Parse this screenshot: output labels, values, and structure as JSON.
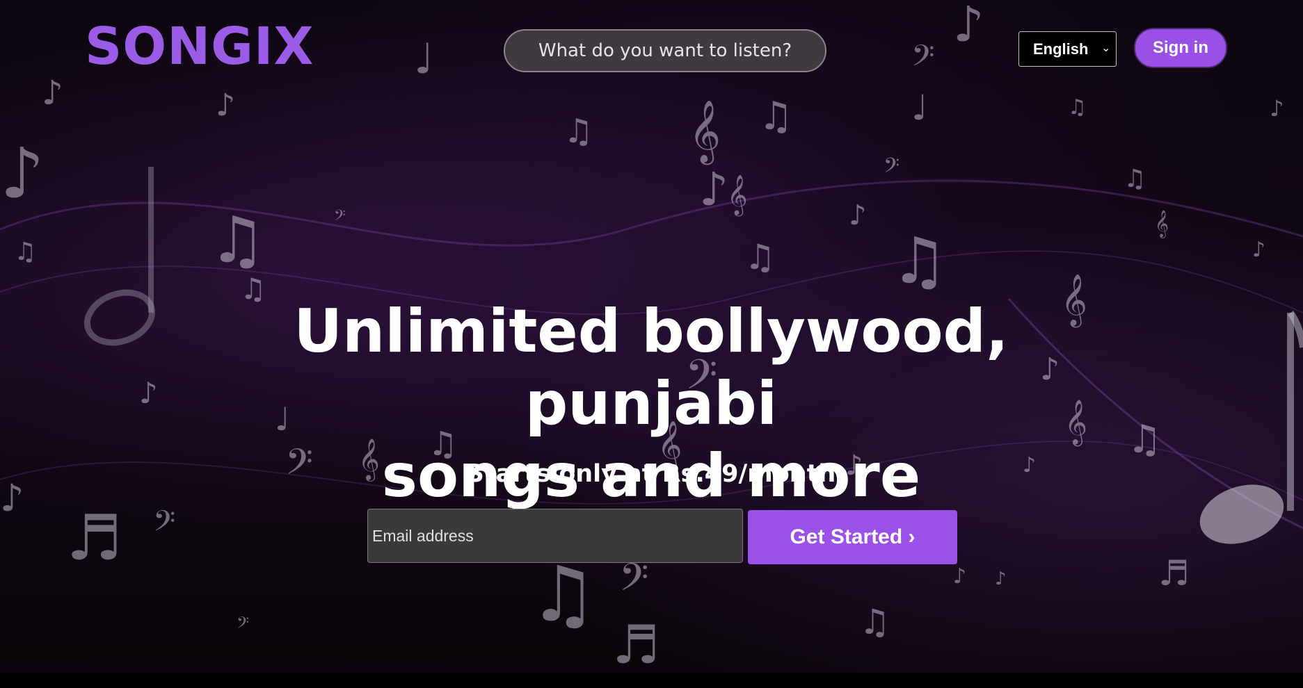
{
  "header": {
    "logo": "SONGIX",
    "search_placeholder": "What do you want to listen?",
    "language_selected": "English",
    "signin_label": "Sign in"
  },
  "hero": {
    "title_line1": "Unlimited bollywood, punjabi",
    "title_line2": "songs and more",
    "subtitle": "Starts only at Rs.49/month",
    "email_placeholder": "Email address",
    "cta_label": "Get Started ›"
  },
  "colors": {
    "accent": "#9a4fe6",
    "logo": "#9a5ce6",
    "background": "#0d0610"
  },
  "icons": {
    "background": "music-notes-pattern",
    "select_arrow": "chevron-down-icon"
  }
}
